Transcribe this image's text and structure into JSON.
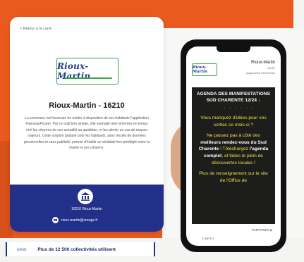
{
  "card": {
    "back_link": "< Retour à la carte",
    "logo_text": "Rioux-Martin",
    "title": "Rioux-Martin - 16210",
    "description": "La commune est heureuse de mettre à disposition de ses habitants l'application PanneauPocket. Par ce outil très simple, elle souhaite tenir informés en temps réel les citoyens de son actualité au quotidien, et les alerter en cas de risques majeurs. Cette solution gratuite pour les habitants, sans récolte de données personnelles et sans publicité, permet d'établir un véritable lien privilégié entre la mairie et ses citoyens.",
    "footer_city": "16210 Rioux-Martin",
    "footer_email": "rioux-martin@orange.fr"
  },
  "bottom_bar": {
    "prefix": "icket",
    "text": "Plus de 12 500 collectivités utilisent"
  },
  "phone": {
    "logo_text": "Rioux-Martin",
    "header_title": "Rioux-Martin",
    "header_sub1": "16210",
    "header_sub2": "Aujourd'hui 07/12/2024",
    "agenda_title": "AGENDA DES MANIFESTATIONS SUD CHARENTE 12/24 ↓",
    "dots": "- - - - - - - -",
    "body_part1": "Vous manquez d'idées pour vos sorties ce mois-ci ?",
    "body_part2": "Ne passez pas à côté des ",
    "body_bold1": "meilleurs rendez-vous du Sud Charente",
    "body_part3": " ! Téléchargez ",
    "body_bold2": "l'agenda complet",
    "body_part4": ", et faites le plein de découvertes locales !",
    "body_part5": "Plus de renseignement sur le site de l'Office de",
    "footer_left": "1 sur 5  >",
    "footer_right": "PARTAGER ⇄"
  },
  "colors": {
    "orange": "#ea5a1e",
    "navy": "#22308a",
    "green": "#3aa345",
    "yellow": "#e8e24b"
  }
}
